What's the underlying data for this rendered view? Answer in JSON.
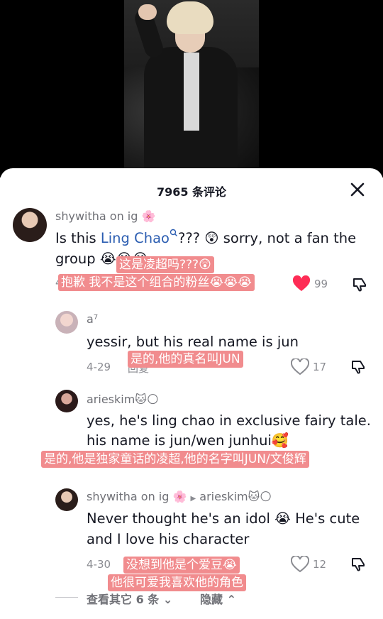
{
  "header": {
    "title": "7965 条评论"
  },
  "comments": [
    {
      "username": "shywitha on ig 🌸",
      "text_before_link": "Is this ",
      "link": "Ling Chao",
      "text_after_link": "??? 😲 sorry, not a fan the",
      "text_line2": "group 😭😭😭",
      "date": "4",
      "subtitle_line1": "这是凌超吗???😲",
      "subtitle_line2": "抱歉 我不是这个组合的粉丝😭😭😭",
      "likes": "99"
    },
    {
      "username": "a⁷",
      "text": "yessir, but his real name is jun",
      "date": "4-29",
      "reply_label": "回复",
      "subtitle": "是的,他的真名叫JUN",
      "likes": "17"
    },
    {
      "username": "arieskim🐱🌕",
      "text_line1": "yes, he's ling chao in exclusive fairy tale.",
      "text_line2": "his name is jun/wen junhui🥰",
      "subtitle": "是的,他是独家童话的凌超,他的名字叫JUN/文俊辉"
    },
    {
      "username": "shywitha on ig 🌸",
      "reply_to": "arieskim🐱🌕",
      "text_line1": "Never thought he's an idol 😭 He's cute",
      "text_line2": "and I love his character",
      "date": "4-30",
      "subtitle_line1": "没想到他是个爱豆😭",
      "subtitle_line2": "他很可爱我喜欢他的角色",
      "likes": "12"
    }
  ],
  "footer": {
    "more_replies": "查看其它 6 条",
    "hide": "隐藏"
  },
  "colors": {
    "accent_link": "#2b5db1",
    "subtitle_bg": "#f18c8e",
    "heart_liked": "#fe2c55"
  }
}
